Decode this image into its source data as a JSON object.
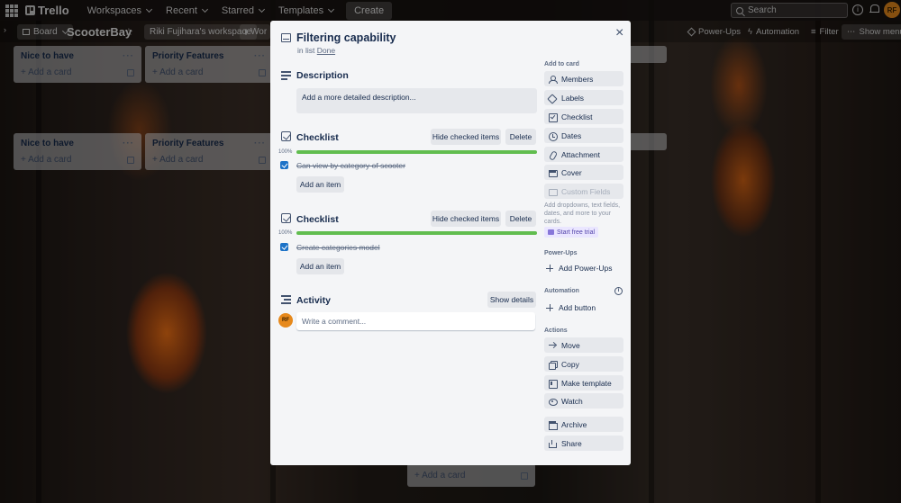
{
  "topnav": {
    "logo": "Trello",
    "items": [
      "Workspaces",
      "Recent",
      "Starred",
      "Templates"
    ],
    "create": "Create",
    "search_placeholder": "Search",
    "avatar_initials": "RF"
  },
  "board": {
    "view": "Board",
    "title": "ScooterBay",
    "workspace": "Riki Fujihara's workspace",
    "workspace_visibility": "Wor",
    "power_ups": "Power-Ups",
    "automation": "Automation",
    "filter": "Filter",
    "show_menu": "Show menu"
  },
  "lists": [
    {
      "title": "Nice to have",
      "add": "Add a card"
    },
    {
      "title": "Priority Features",
      "add": "Add a card"
    },
    {
      "title": "Nice to have",
      "add": "Add a card"
    },
    {
      "title": "Priority Features",
      "add": "Add a card"
    },
    {
      "title": "",
      "add": "Add a card"
    }
  ],
  "card": {
    "title": "Filtering capability",
    "in_list_prefix": "in list",
    "list_name": "Done",
    "description_heading": "Description",
    "description_placeholder": "Add a more detailed description...",
    "checklists": [
      {
        "title": "Checklist",
        "hide_checked": "Hide checked items",
        "delete": "Delete",
        "progress_label": "100%",
        "progress": 1.0,
        "items": [
          {
            "text": "Can view by category of scooter",
            "checked": true
          }
        ],
        "add_item": "Add an item"
      },
      {
        "title": "Checklist",
        "hide_checked": "Hide checked items",
        "delete": "Delete",
        "progress_label": "100%",
        "progress": 1.0,
        "items": [
          {
            "text": "Create categories model",
            "checked": true
          }
        ],
        "add_item": "Add an item"
      }
    ],
    "activity_heading": "Activity",
    "show_details": "Show details",
    "comment_placeholder": "Write a comment...",
    "commenter_initials": "RF"
  },
  "sidebar": {
    "add_to_card_label": "Add to card",
    "add_to_card": [
      "Members",
      "Labels",
      "Checklist",
      "Dates",
      "Attachment",
      "Cover",
      "Custom Fields"
    ],
    "help_text": "Add dropdowns, text fields, dates, and more to your cards.",
    "trial": "Start free trial",
    "power_ups_label": "Power-Ups",
    "add_power_ups": "Add Power-Ups",
    "automation_label": "Automation",
    "add_button": "Add button",
    "actions_label": "Actions",
    "actions": [
      "Move",
      "Copy",
      "Make template",
      "Watch"
    ],
    "archive": "Archive",
    "share": "Share"
  },
  "colors": {
    "progress": "#61bd4f",
    "checkbox": "#1c72c7",
    "avatar": "#e6891c"
  }
}
